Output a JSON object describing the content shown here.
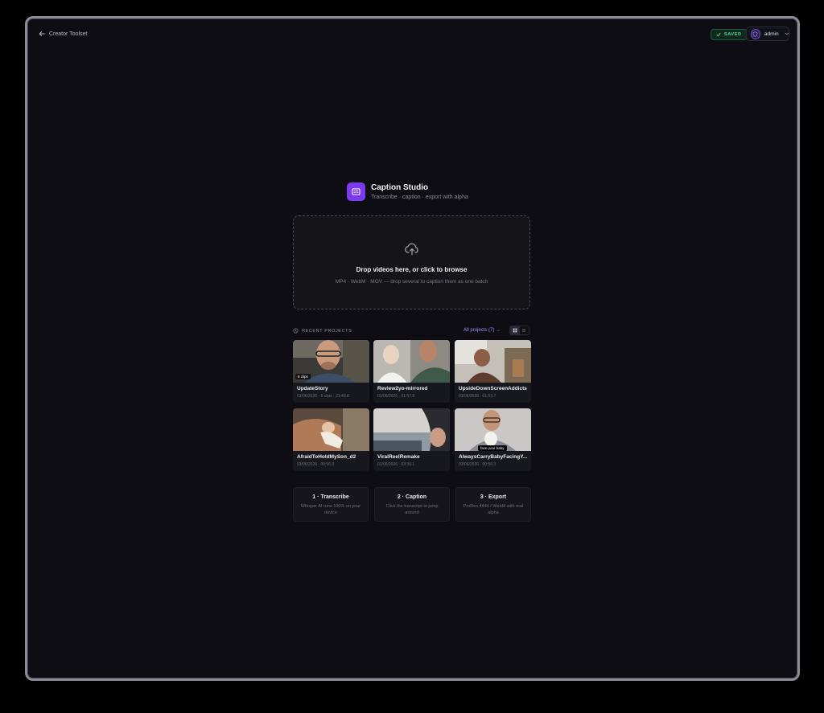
{
  "nav": {
    "back_label": "Creator Toolset"
  },
  "status": {
    "saved_label": "SAVED"
  },
  "user": {
    "name": "admin"
  },
  "app": {
    "title": "Caption Studio",
    "subtitle": "Transcribe · caption · export with alpha"
  },
  "dropzone": {
    "title": "Drop videos here, or click to browse",
    "subtitle": "MP4 · WebM · MOV — drop several to caption them as one batch"
  },
  "recent": {
    "label": "RECENT PROJECTS",
    "all_link": "All projects (7) →",
    "projects": [
      {
        "title": "UpdateStory",
        "meta": "03/06/2026 · 6 clips · 21:49.8",
        "badge": "6 clips"
      },
      {
        "title": "Review2yo-mirrored",
        "meta": "01/06/2026 · 01:57.8"
      },
      {
        "title": "UpsideDownScreenAddicts",
        "meta": "03/06/2026 · 01:53.7"
      },
      {
        "title": "AfraidToHoldMySon_d2",
        "meta": "03/06/2026 · 00:56.3"
      },
      {
        "title": "ViralReelRemake",
        "meta": "01/06/2026 · 03:30.1"
      },
      {
        "title": "AlwaysCarryBabyFacingY...",
        "meta": "03/06/2026 · 00:56.3",
        "overlay": "face your baby"
      }
    ]
  },
  "steps": [
    {
      "title": "1 · Transcribe",
      "desc": "Whisper AI runs 100% on your device"
    },
    {
      "title": "2 · Caption",
      "desc": "Click the transcript to jump around"
    },
    {
      "title": "3 · Export",
      "desc": "ProRes 4444 / WebM with real alpha"
    }
  ],
  "colors": {
    "accent": "#7c3aed",
    "link": "#a78bfa",
    "saved": "#5fd39a",
    "background": "#0d0d13"
  }
}
